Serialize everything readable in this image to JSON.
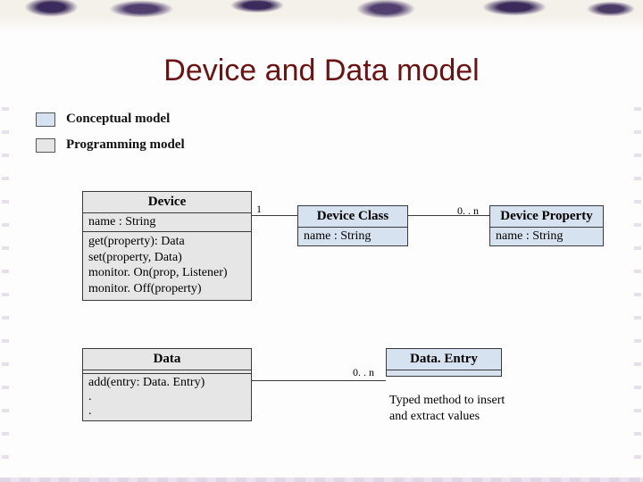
{
  "slide": {
    "title": "Device and Data model"
  },
  "legend": {
    "conceptual": "Conceptual model",
    "programming": "Programming model"
  },
  "boxes": {
    "device": {
      "title": "Device",
      "attr1": "name : String",
      "op1": "get(property): Data",
      "op2": "set(property, Data)",
      "op3": "monitor. On(prop, Listener)",
      "op4": "monitor. Off(property)"
    },
    "deviceClass": {
      "title": "Device Class",
      "attr1": "name : String"
    },
    "deviceProperty": {
      "title": "Device Property",
      "attr1": "name : String"
    },
    "data": {
      "title": "Data",
      "op1": "add(entry: Data. Entry)",
      "op2": ".",
      "op3": "."
    },
    "dataEntry": {
      "title": "Data. Entry"
    }
  },
  "mult": {
    "one": "1",
    "zeroN_a": "0. . n",
    "zeroN_b": "0. . n"
  },
  "notes": {
    "typed": "Typed method to insert and extract values"
  }
}
